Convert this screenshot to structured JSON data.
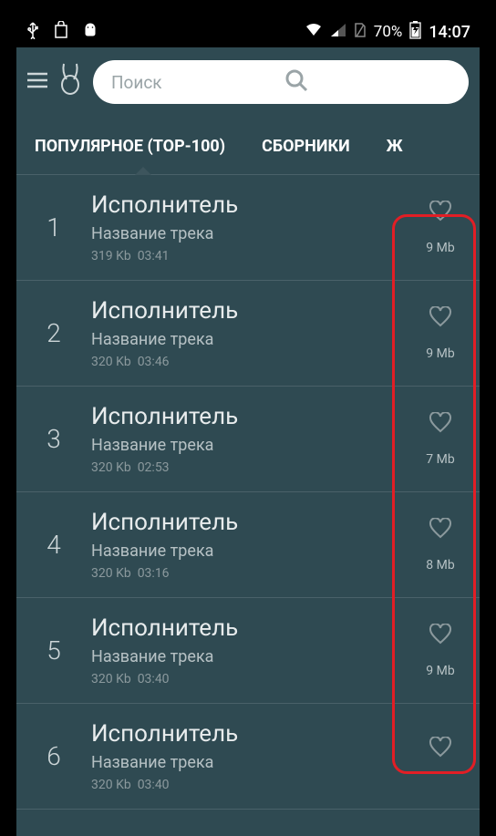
{
  "status": {
    "battery_pct": "70%",
    "time": "14:07"
  },
  "search": {
    "placeholder": "Поиск"
  },
  "tabs": {
    "popular": "ПОПУЛЯРНОЕ (TOP-100)",
    "collections": "СБОРНИКИ",
    "partial": "Ж"
  },
  "tracks": [
    {
      "rank": "1",
      "artist": "Исполнитель",
      "title": "Название трека",
      "bitrate": "319 Kb",
      "duration": "03:41",
      "size": "9 Mb"
    },
    {
      "rank": "2",
      "artist": "Исполнитель",
      "title": "Название трека",
      "bitrate": "320 Kb",
      "duration": "03:46",
      "size": "9 Mb"
    },
    {
      "rank": "3",
      "artist": "Исполнитель",
      "title": "Название трека",
      "bitrate": "320 Kb",
      "duration": "02:53",
      "size": "7 Mb"
    },
    {
      "rank": "4",
      "artist": "Исполнитель",
      "title": "Название трека",
      "bitrate": "320 Kb",
      "duration": "03:16",
      "size": "8 Mb"
    },
    {
      "rank": "5",
      "artist": "Исполнитель",
      "title": "Название трека",
      "bitrate": "320 Kb",
      "duration": "03:40",
      "size": "9 Mb"
    },
    {
      "rank": "6",
      "artist": "Исполнитель",
      "title": "Название трека",
      "bitrate": "320 Kb",
      "duration": "03:40",
      "size": ""
    }
  ]
}
